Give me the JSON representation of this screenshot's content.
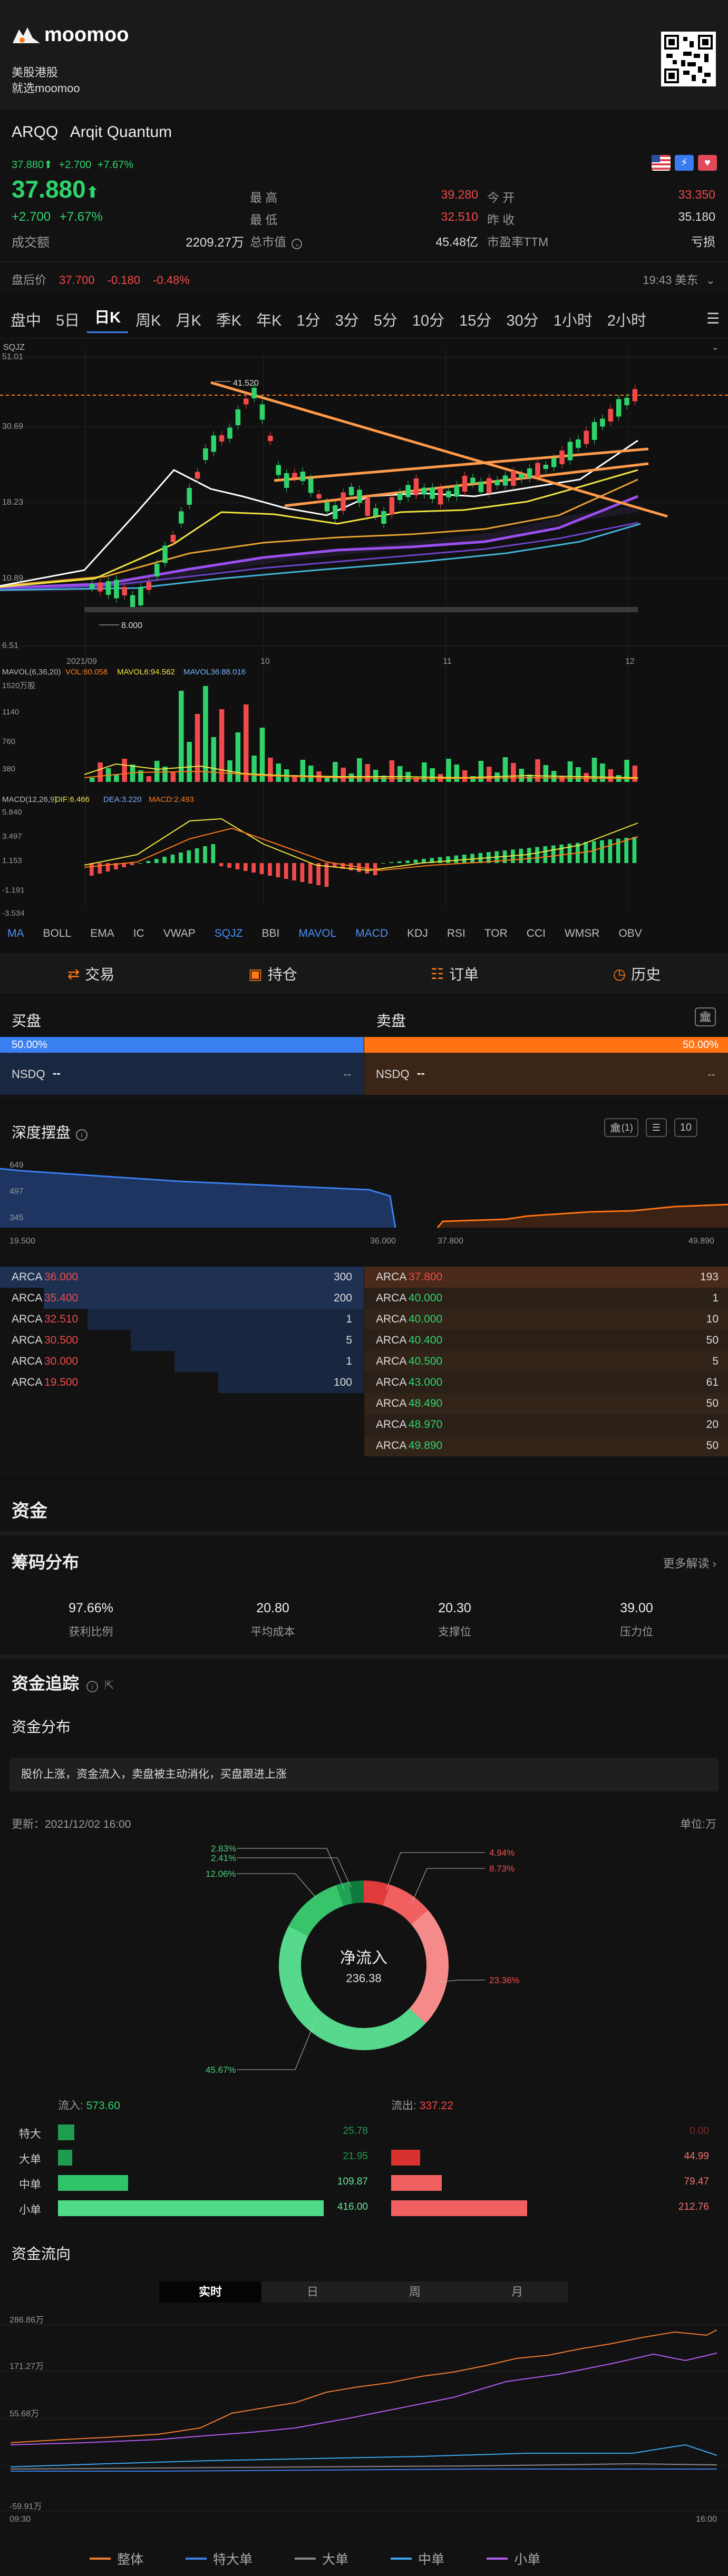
{
  "app": {
    "logo": "moomoo",
    "sub1": "美股港股",
    "sub2": "就选moomoo"
  },
  "stock": {
    "symbol": "ARQQ",
    "name": "Arqit Quantum",
    "small_price": "37.880",
    "small_change": "+2.700",
    "small_pct": "+7.67%",
    "price": "37.880",
    "change": "+2.700",
    "pct": "+7.67%",
    "volume_label": "成交额",
    "volume": "2209.27万",
    "mktcap_label": "总市值",
    "high_label": "最 高",
    "high": "39.280",
    "low_label": "最 低",
    "low": "32.510",
    "mktcap": "45.48亿",
    "open_label": "今 开",
    "open": "33.350",
    "close_label": "昨 收",
    "close": "35.180",
    "pe_label": "市盈率TTM",
    "pe": "亏损",
    "after_label": "盘后价",
    "after_price": "37.700",
    "after_change": "-0.180",
    "after_pct": "-0.48%",
    "time": "19:43 美东"
  },
  "chart_tabs": [
    "盘中",
    "5日",
    "日K",
    "周K",
    "月K",
    "季K",
    "年K",
    "1分",
    "3分",
    "5分",
    "10分",
    "15分",
    "30分",
    "1小时",
    "2小时"
  ],
  "active_tab": "日K",
  "chart": {
    "indicator": "SQJZ",
    "y_labels": [
      "51.01",
      "30.69",
      "18.23",
      "10.89",
      "6.51"
    ],
    "high_marker": "41.520",
    "low_marker": "8.000",
    "x_labels": [
      "2021/09",
      "10",
      "11",
      "12"
    ],
    "mavol_text": "MAVOL(6,36,20)",
    "vol60": "VOL:60.058",
    "mavol6": "MAVOL6:94.562",
    "mavol36": "MAVOL36:88.016",
    "vol_labels": [
      "1520万股",
      "1140",
      "760",
      "380"
    ],
    "macd_text": "MACD(12,26,9)",
    "dif": "DIF:6.466",
    "dea": "DEA:3.220",
    "macd": "MACD:2.493",
    "macd_labels": [
      "5.840",
      "3.497",
      "1.153",
      "-1.191",
      "-3.534"
    ]
  },
  "indicators": [
    "MA",
    "BOLL",
    "EMA",
    "IC",
    "VWAP",
    "SQJZ",
    "BBI",
    "MAVOL",
    "MACD",
    "KDJ",
    "RSI",
    "TOR",
    "CCI",
    "WMSR",
    "OBV"
  ],
  "actions": [
    "交易",
    "持仓",
    "订单",
    "历史"
  ],
  "book": {
    "bid_title": "买盘",
    "ask_title": "卖盘",
    "bid_pct": "50.00%",
    "ask_pct": "50.00%",
    "bid_ex": "NSDQ",
    "ask_ex": "NSDQ",
    "dash": "--"
  },
  "depth": {
    "title": "深度摆盘",
    "badge": "(1)",
    "count": "10",
    "y_labels": [
      "649",
      "497",
      "345"
    ],
    "x_labels": [
      "19.500",
      "36.000",
      "37.800",
      "49.890"
    ],
    "bids": [
      {
        "ex": "ARCA",
        "price": "36.000",
        "qty": "300"
      },
      {
        "ex": "ARCA",
        "price": "35.400",
        "qty": "200"
      },
      {
        "ex": "ARCA",
        "price": "32.510",
        "qty": "1"
      },
      {
        "ex": "ARCA",
        "price": "30.500",
        "qty": "5"
      },
      {
        "ex": "ARCA",
        "price": "30.000",
        "qty": "1"
      },
      {
        "ex": "ARCA",
        "price": "19.500",
        "qty": "100"
      }
    ],
    "asks": [
      {
        "ex": "ARCA",
        "price": "37.800",
        "qty": "193"
      },
      {
        "ex": "ARCA",
        "price": "40.000",
        "qty": "1"
      },
      {
        "ex": "ARCA",
        "price": "40.000",
        "qty": "10"
      },
      {
        "ex": "ARCA",
        "price": "40.400",
        "qty": "50"
      },
      {
        "ex": "ARCA",
        "price": "40.500",
        "qty": "5"
      },
      {
        "ex": "ARCA",
        "price": "43.000",
        "qty": "61"
      },
      {
        "ex": "ARCA",
        "price": "48.490",
        "qty": "50"
      },
      {
        "ex": "ARCA",
        "price": "48.970",
        "qty": "20"
      },
      {
        "ex": "ARCA",
        "price": "49.890",
        "qty": "50"
      }
    ]
  },
  "funds": {
    "title": "资金",
    "chip_title": "筹码分布",
    "more": "更多解读",
    "chip": [
      {
        "value": "97.66%",
        "label": "获利比例"
      },
      {
        "value": "20.80",
        "label": "平均成本"
      },
      {
        "value": "20.30",
        "label": "支撑位"
      },
      {
        "value": "39.00",
        "label": "压力位"
      }
    ],
    "track_title": "资金追踪",
    "dist_title": "资金分布",
    "note": "股价上涨，资金流入，卖盘被主动消化，买盘跟进上涨",
    "updated": "更新：2021/12/02 16:00",
    "unit": "单位:万",
    "donut_center": "净流入",
    "donut_value": "236.38",
    "donut_labels_left": [
      "2.83%",
      "2.41%",
      "12.06%",
      "45.67%"
    ],
    "donut_labels_right": [
      "4.94%",
      "8.73%",
      "23.36%"
    ],
    "in_label": "流入:",
    "in_total": "573.60",
    "out_label": "流出:",
    "out_total": "337.22",
    "rows": [
      {
        "label": "特大",
        "in": "25.78",
        "out": "0.00"
      },
      {
        "label": "大单",
        "in": "21.95",
        "out": "44.99"
      },
      {
        "label": "中单",
        "in": "109.87",
        "out": "79.47"
      },
      {
        "label": "小单",
        "in": "416.00",
        "out": "212.76"
      }
    ],
    "flow_title": "资金流向",
    "flow_tabs": [
      "实时",
      "日",
      "周",
      "月"
    ],
    "flow_y": [
      "286.86万",
      "171.27万",
      "55.68万",
      "-59.91万"
    ],
    "flow_x": [
      "09:30",
      "16:00"
    ],
    "legend": [
      "整体",
      "特大单",
      "大单",
      "中单",
      "小单"
    ],
    "colors": {
      "overall": "#ee7b2f",
      "xl": "#3d7fe8",
      "large": "#888888",
      "mid": "#39a6ee",
      "small": "#b05bf0"
    }
  },
  "chart_data": {
    "type": "pie",
    "categories": [
      "特大流入",
      "大单流入",
      "中单流入",
      "小单流入",
      "特大流出",
      "大单流出",
      "中单流出",
      "小单流出"
    ],
    "values": [
      2.83,
      2.41,
      12.06,
      45.67,
      0,
      4.94,
      8.73,
      23.36
    ]
  }
}
